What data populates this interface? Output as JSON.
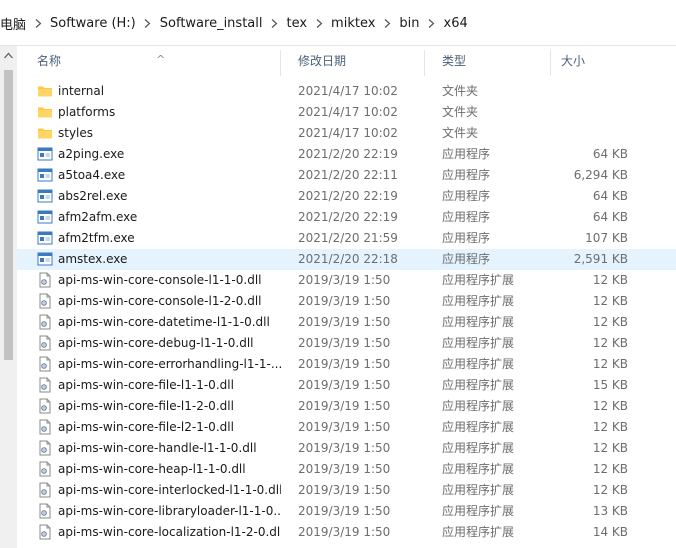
{
  "breadcrumb": [
    "电脑",
    "Software (H:)",
    "Software_install",
    "tex",
    "miktex",
    "bin",
    "x64"
  ],
  "columns": {
    "name": "名称",
    "date": "修改日期",
    "type": "类型",
    "size": "大小"
  },
  "colors": {
    "selected_row": "#e5f3ff",
    "folder": "#ffc83d",
    "header_text": "#4c607a"
  },
  "files": [
    {
      "name": "internal",
      "date": "2021/4/17 10:02",
      "type": "文件夹",
      "size": "",
      "icon": "folder-icon"
    },
    {
      "name": "platforms",
      "date": "2021/4/17 10:02",
      "type": "文件夹",
      "size": "",
      "icon": "folder-icon"
    },
    {
      "name": "styles",
      "date": "2021/4/17 10:02",
      "type": "文件夹",
      "size": "",
      "icon": "folder-icon"
    },
    {
      "name": "a2ping.exe",
      "date": "2021/2/20 22:19",
      "type": "应用程序",
      "size": "64 KB",
      "icon": "exe-icon"
    },
    {
      "name": "a5toa4.exe",
      "date": "2021/2/20 22:11",
      "type": "应用程序",
      "size": "6,294 KB",
      "icon": "exe-icon"
    },
    {
      "name": "abs2rel.exe",
      "date": "2021/2/20 22:19",
      "type": "应用程序",
      "size": "64 KB",
      "icon": "exe-icon"
    },
    {
      "name": "afm2afm.exe",
      "date": "2021/2/20 22:19",
      "type": "应用程序",
      "size": "64 KB",
      "icon": "exe-icon"
    },
    {
      "name": "afm2tfm.exe",
      "date": "2021/2/20 21:59",
      "type": "应用程序",
      "size": "107 KB",
      "icon": "exe-icon"
    },
    {
      "name": "amstex.exe",
      "date": "2021/2/20 22:18",
      "type": "应用程序",
      "size": "2,591 KB",
      "icon": "exe-icon",
      "selected": true
    },
    {
      "name": "api-ms-win-core-console-l1-1-0.dll",
      "date": "2019/3/19 1:50",
      "type": "应用程序扩展",
      "size": "12 KB",
      "icon": "dll-icon"
    },
    {
      "name": "api-ms-win-core-console-l1-2-0.dll",
      "date": "2019/3/19 1:50",
      "type": "应用程序扩展",
      "size": "12 KB",
      "icon": "dll-icon"
    },
    {
      "name": "api-ms-win-core-datetime-l1-1-0.dll",
      "date": "2019/3/19 1:50",
      "type": "应用程序扩展",
      "size": "12 KB",
      "icon": "dll-icon"
    },
    {
      "name": "api-ms-win-core-debug-l1-1-0.dll",
      "date": "2019/3/19 1:50",
      "type": "应用程序扩展",
      "size": "12 KB",
      "icon": "dll-icon"
    },
    {
      "name": "api-ms-win-core-errorhandling-l1-1-...",
      "date": "2019/3/19 1:50",
      "type": "应用程序扩展",
      "size": "12 KB",
      "icon": "dll-icon"
    },
    {
      "name": "api-ms-win-core-file-l1-1-0.dll",
      "date": "2019/3/19 1:50",
      "type": "应用程序扩展",
      "size": "15 KB",
      "icon": "dll-icon"
    },
    {
      "name": "api-ms-win-core-file-l1-2-0.dll",
      "date": "2019/3/19 1:50",
      "type": "应用程序扩展",
      "size": "12 KB",
      "icon": "dll-icon"
    },
    {
      "name": "api-ms-win-core-file-l2-1-0.dll",
      "date": "2019/3/19 1:50",
      "type": "应用程序扩展",
      "size": "12 KB",
      "icon": "dll-icon"
    },
    {
      "name": "api-ms-win-core-handle-l1-1-0.dll",
      "date": "2019/3/19 1:50",
      "type": "应用程序扩展",
      "size": "12 KB",
      "icon": "dll-icon"
    },
    {
      "name": "api-ms-win-core-heap-l1-1-0.dll",
      "date": "2019/3/19 1:50",
      "type": "应用程序扩展",
      "size": "12 KB",
      "icon": "dll-icon"
    },
    {
      "name": "api-ms-win-core-interlocked-l1-1-0.dll",
      "date": "2019/3/19 1:50",
      "type": "应用程序扩展",
      "size": "12 KB",
      "icon": "dll-icon"
    },
    {
      "name": "api-ms-win-core-libraryloader-l1-1-0....",
      "date": "2019/3/19 1:50",
      "type": "应用程序扩展",
      "size": "13 KB",
      "icon": "dll-icon"
    },
    {
      "name": "api-ms-win-core-localization-l1-2-0.dll",
      "date": "2019/3/19 1:50",
      "type": "应用程序扩展",
      "size": "14 KB",
      "icon": "dll-icon"
    }
  ]
}
